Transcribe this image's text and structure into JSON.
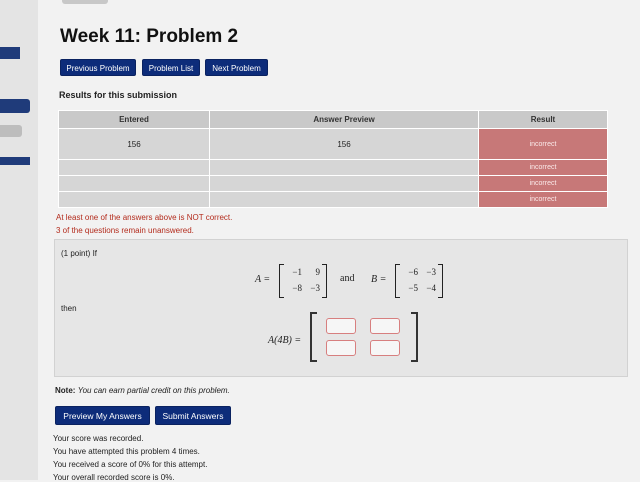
{
  "page": {
    "title": "Week 11: Problem 2"
  },
  "nav": {
    "previous": "Previous Problem",
    "list": "Problem List",
    "next": "Next Problem"
  },
  "results": {
    "heading": "Results for this submission",
    "headers": [
      "Entered",
      "Answer Preview",
      "Result"
    ],
    "rows": [
      {
        "entered": "156",
        "preview": "156",
        "result": "incorrect"
      },
      {
        "entered": "",
        "preview": "",
        "result": "incorrect"
      },
      {
        "entered": "",
        "preview": "",
        "result": "incorrect"
      },
      {
        "entered": "",
        "preview": "",
        "result": "incorrect"
      }
    ]
  },
  "messages": {
    "not_correct": "At least one of the answers above is NOT correct.",
    "unanswered": "3 of the questions remain unanswered."
  },
  "problem": {
    "points_intro": "(1 point) If",
    "then": "then",
    "and": "and",
    "matrix_A": {
      "label": "A =",
      "cells": [
        "−1",
        "9",
        "−8",
        "−3"
      ]
    },
    "matrix_B": {
      "label": "B =",
      "cells": [
        "−6",
        "−3",
        "−5",
        "−4"
      ]
    },
    "answer_label": "A(4B) ="
  },
  "note": {
    "label": "Note:",
    "text": "You can earn partial credit on this problem."
  },
  "actions": {
    "preview": "Preview My Answers",
    "submit": "Submit Answers"
  },
  "status": {
    "recorded": "Your score was recorded.",
    "attempts": "You have attempted this problem 4 times.",
    "score_attempt": "You received a score of 0% for this attempt.",
    "overall": "Your overall recorded score is 0%."
  }
}
